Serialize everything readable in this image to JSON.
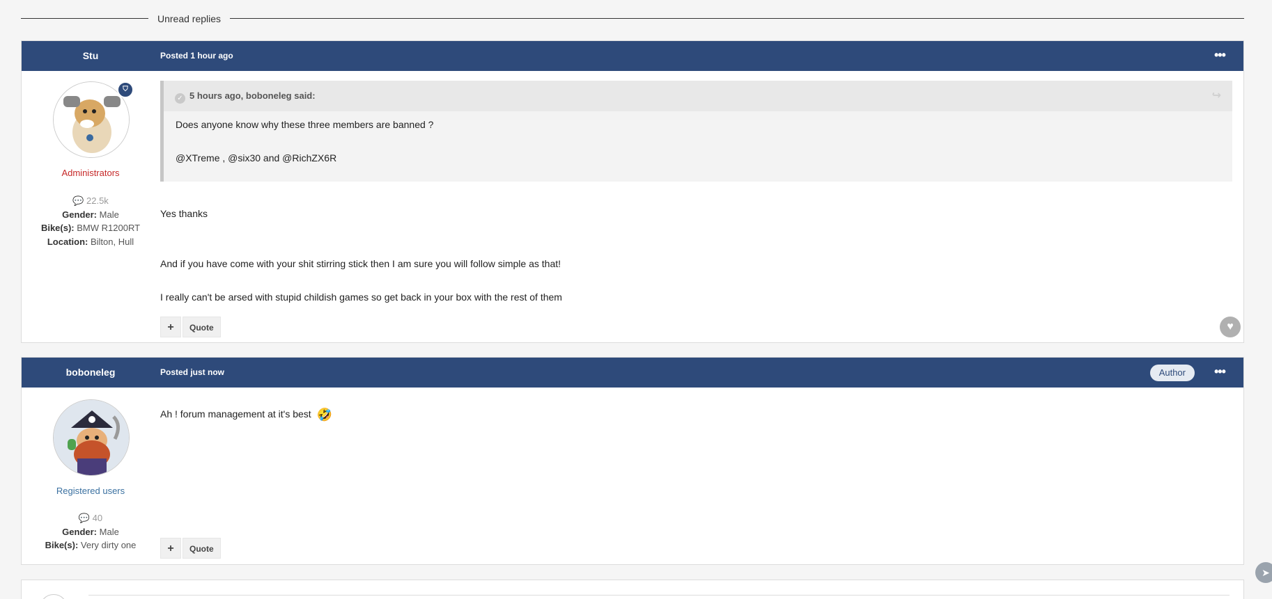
{
  "divider": {
    "label": "Unread replies"
  },
  "posts": [
    {
      "author": "Stu",
      "posted": "Posted 1 hour ago",
      "group": "Administrators",
      "post_count": "22.5k",
      "fields": [
        {
          "label": "Gender:",
          "value": "Male"
        },
        {
          "label": "Bike(s):",
          "value": "BMW R1200RT"
        },
        {
          "label": "Location:",
          "value": "Bilton, Hull"
        }
      ],
      "quote": {
        "header": "5 hours ago, boboneleg said:",
        "lines": [
          "Does anyone know why these three members are banned ?",
          "@XTreme , @six30 and @RichZX6R"
        ]
      },
      "body": [
        "Yes thanks",
        "And if you have come with your shit stirring stick then I am sure you will follow simple as that!",
        "I really can't be arsed with stupid childish games so get back in your box with the rest of them"
      ],
      "actions": {
        "plus": "+",
        "quote": "Quote"
      }
    },
    {
      "author": "boboneleg",
      "posted": "Posted just now",
      "badge": "Author",
      "group": "Registered users",
      "post_count": "40",
      "fields": [
        {
          "label": "Gender:",
          "value": "Male"
        },
        {
          "label": "Bike(s):",
          "value": "Very dirty one"
        }
      ],
      "body": [
        "Ah ! forum management at it's best"
      ],
      "emoji": "🤣",
      "actions": {
        "plus": "+",
        "quote": "Quote"
      }
    }
  ],
  "colors": {
    "header_bg": "#2e4a7a",
    "admin_group": "#c62828",
    "registered_group": "#3a70a0"
  },
  "icons": {
    "menu": "ellipsis-icon",
    "comment": "comment-icon",
    "like": "heart-icon",
    "quote_toggle": "check-circle-icon",
    "share": "share-icon",
    "moderator": "shield-icon",
    "scroll": "arrow-up-icon"
  }
}
